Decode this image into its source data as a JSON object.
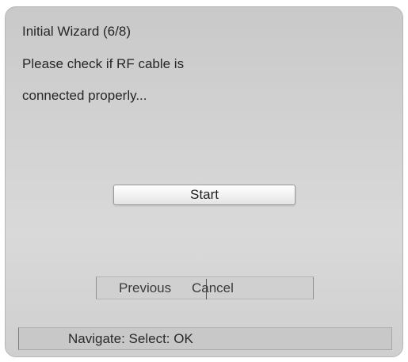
{
  "dialog": {
    "title": "Initial Wizard (6/8)",
    "message_line_1": "Please check if RF cable is",
    "message_line_2": "connected properly..."
  },
  "buttons": {
    "start_label": "Start",
    "previous_label": "Previous",
    "cancel_label": "Cancel"
  },
  "status_bar": {
    "text": "Navigate: Select: OK"
  },
  "colors": {
    "dialog_background": "#d2d2d2",
    "text": "#262626",
    "button_background": "#f1f1f1"
  }
}
